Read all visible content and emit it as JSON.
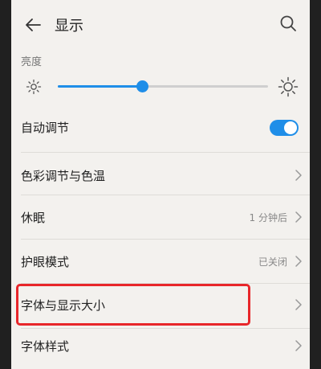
{
  "header": {
    "title": "显示",
    "back_icon": "arrow-left-icon",
    "search_icon": "search-icon"
  },
  "brightness": {
    "section_label": "亮度",
    "level": 0.4,
    "auto_label": "自动调节",
    "auto_enabled": true
  },
  "items": [
    {
      "label": "色彩调节与色温",
      "value": ""
    },
    {
      "label": "休眠",
      "value": "1 分钟后"
    },
    {
      "label": "护眼模式",
      "value": "已关闭"
    },
    {
      "label": "字体与显示大小",
      "value": ""
    },
    {
      "label": "字体样式",
      "value": ""
    }
  ],
  "colors": {
    "accent": "#1f8ee8",
    "highlight": "#e8262a",
    "background": "#f3f1ee"
  }
}
